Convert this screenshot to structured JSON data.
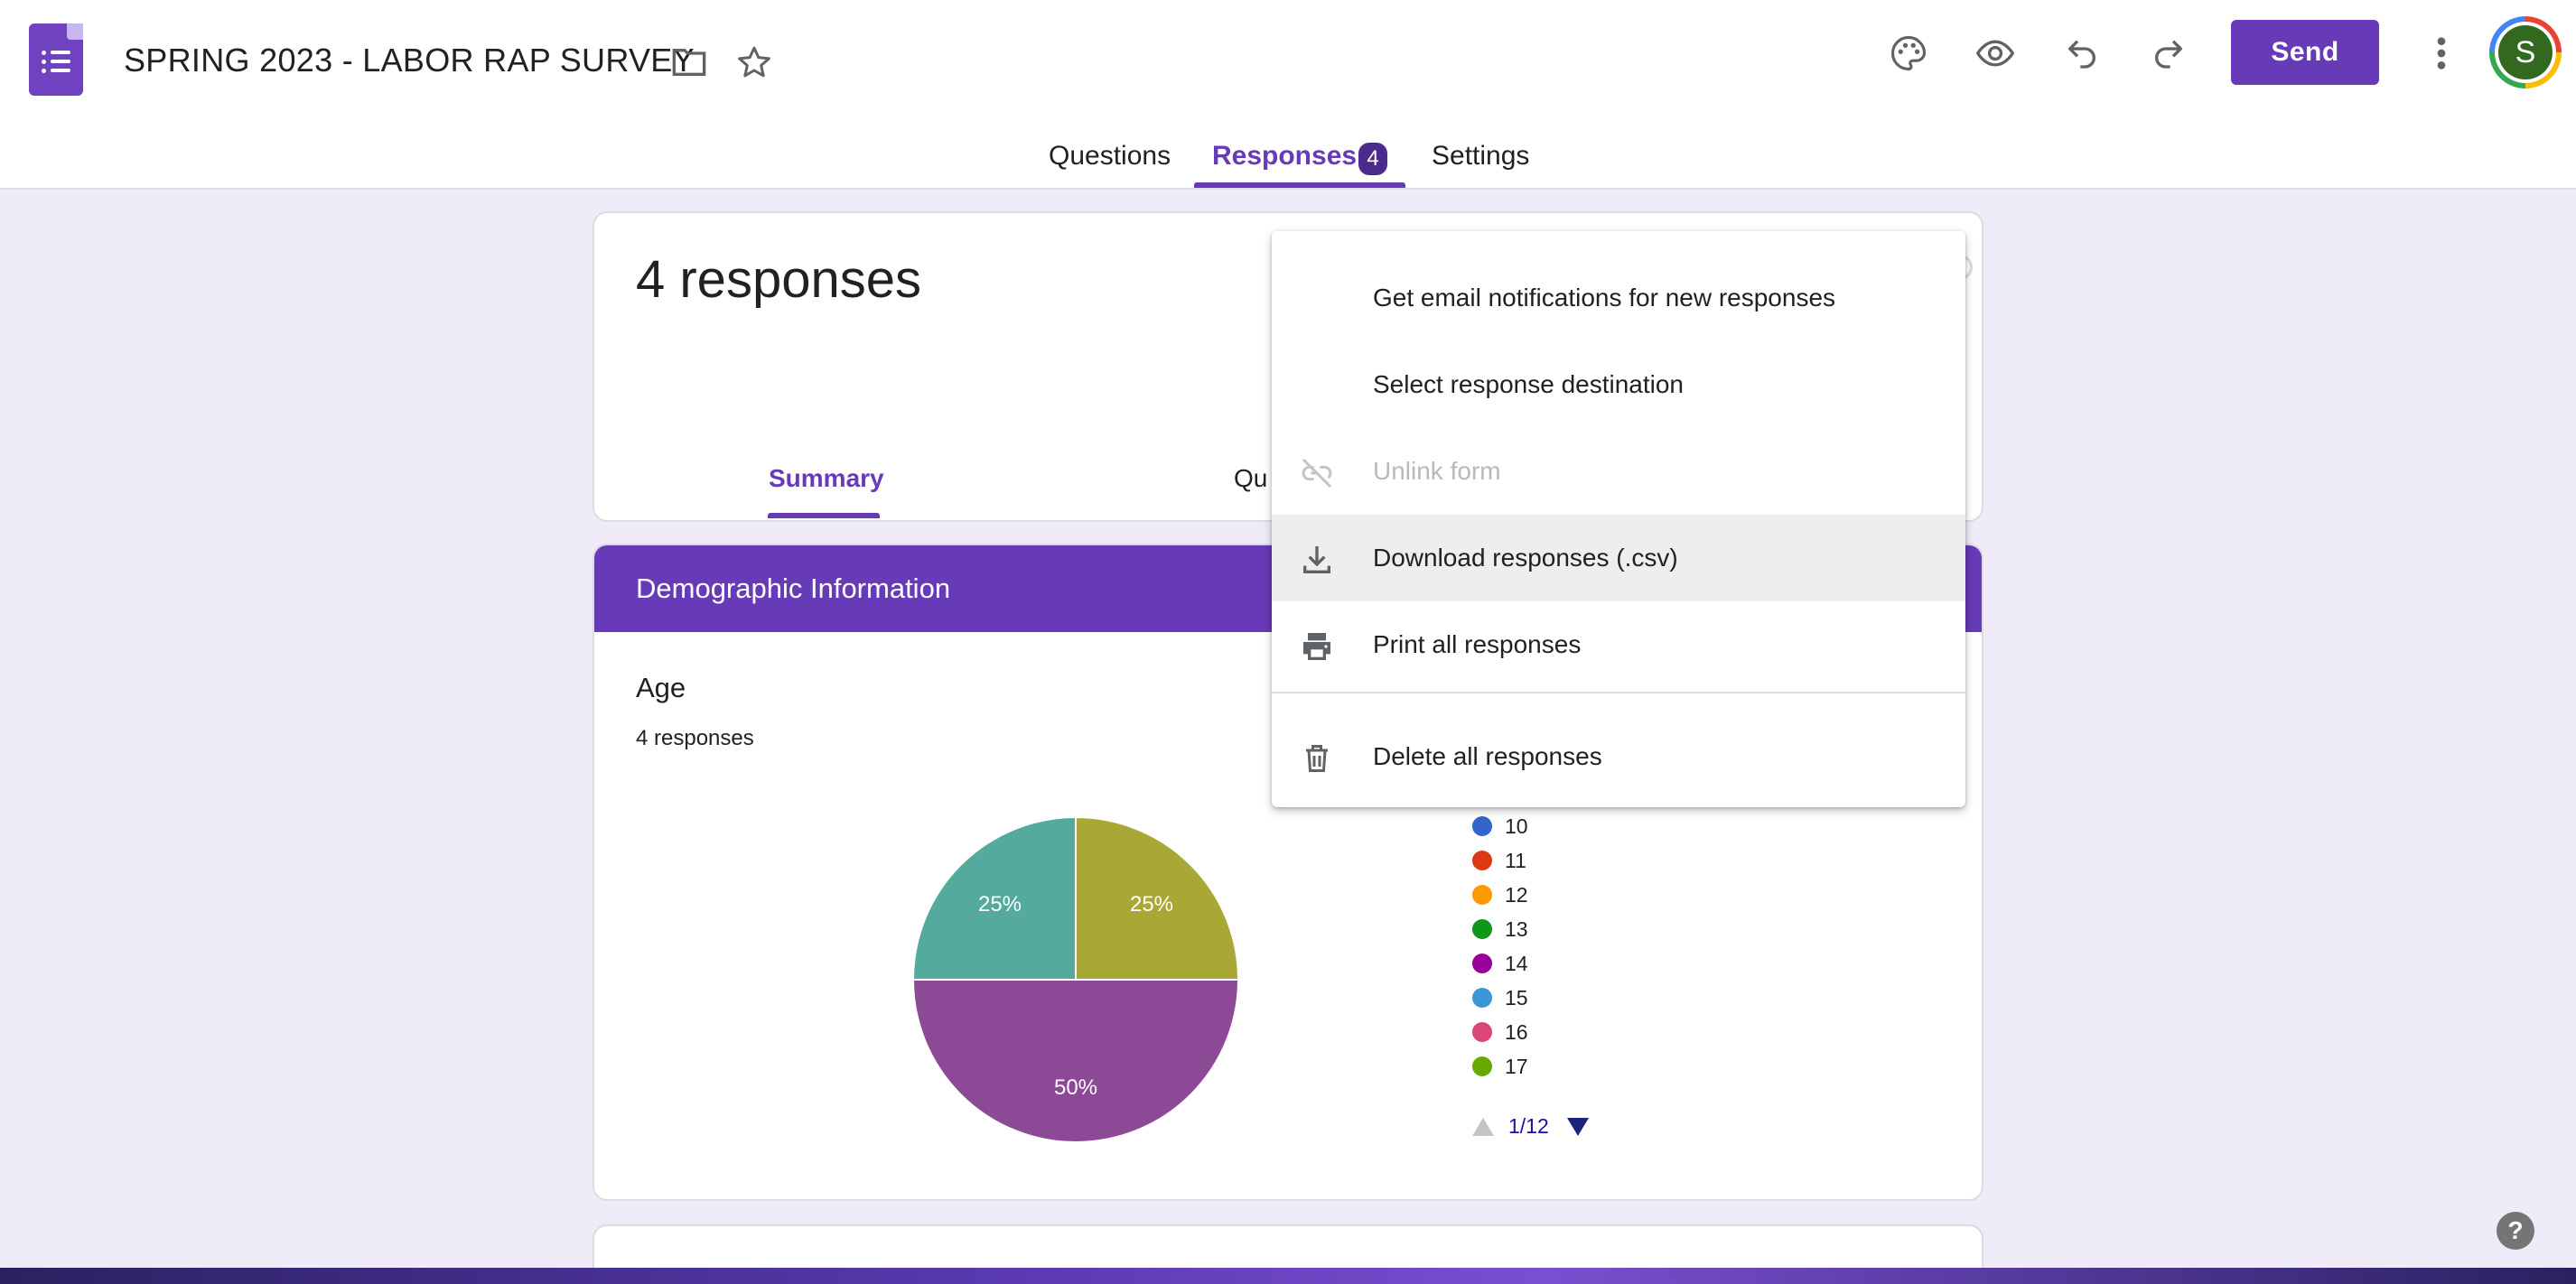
{
  "app": {
    "title": "SPRING 2023 - LABOR RAP SURVEY",
    "send_label": "Send",
    "avatar_initial": "S"
  },
  "tabs": {
    "questions": "Questions",
    "responses": "Responses",
    "responses_badge": "4",
    "settings": "Settings"
  },
  "summary_card": {
    "count_label": "4 responses",
    "subtabs": [
      "Summary",
      "Qu"
    ]
  },
  "section": {
    "title": "Demographic Information",
    "question_title": "Age",
    "question_count": "4 responses"
  },
  "menu": {
    "items": [
      {
        "label": "Get email notifications for new responses",
        "icon": "none"
      },
      {
        "label": "Select response destination",
        "icon": "none"
      },
      {
        "label": "Unlink form",
        "icon": "link-off-icon",
        "disabled": true
      },
      {
        "label": "Download responses (.csv)",
        "icon": "download-icon"
      },
      {
        "label": "Print all responses",
        "icon": "print-icon"
      },
      {
        "label": "Delete all responses",
        "icon": "trash-icon"
      }
    ]
  },
  "chart_data": {
    "type": "pie",
    "slices": [
      {
        "label": "25%",
        "value": 25,
        "color": "#a9a837"
      },
      {
        "label": "50%",
        "value": 50,
        "color": "#8c4a96"
      },
      {
        "label": "25%",
        "value": 25,
        "color": "#53aa9d"
      }
    ],
    "legend": [
      {
        "label": "10",
        "color": "#3366cc"
      },
      {
        "label": "11",
        "color": "#dc3912"
      },
      {
        "label": "12",
        "color": "#ff9900"
      },
      {
        "label": "13",
        "color": "#109618"
      },
      {
        "label": "14",
        "color": "#990099"
      },
      {
        "label": "15",
        "color": "#3b97d3"
      },
      {
        "label": "16",
        "color": "#dd4477"
      },
      {
        "label": "17",
        "color": "#66aa00"
      }
    ],
    "pager": "1/12"
  },
  "colors": {
    "accent": "#673ab7",
    "background": "#efebf8"
  }
}
